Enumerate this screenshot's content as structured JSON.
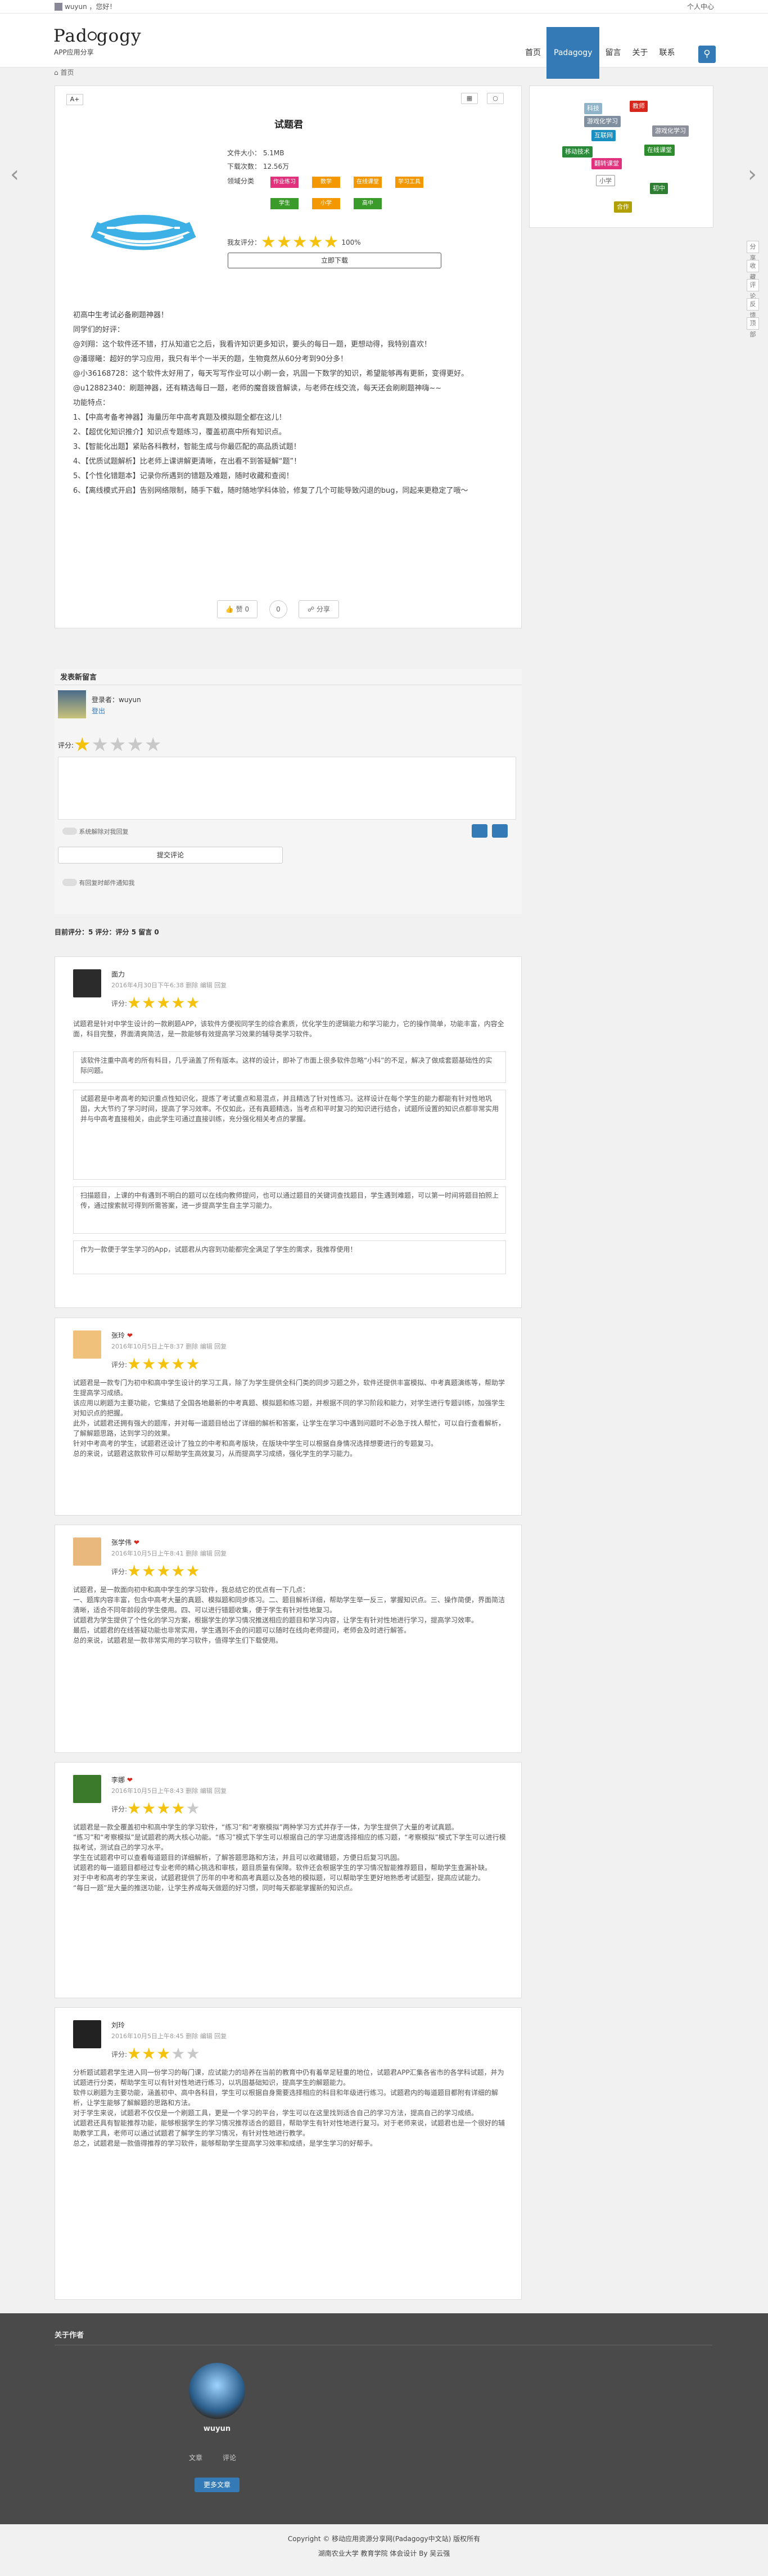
{
  "topbar": {
    "greeting": "wuyun ，您好！",
    "personal": "个人中心"
  },
  "nav": {
    "logo_left": "Pad",
    "logo_right": "gogy",
    "slogan": "APP应用分享",
    "menu": [
      "首页",
      "Padagogy",
      "留言",
      "关于",
      "联系"
    ]
  },
  "breadcrumb": "首页",
  "app": {
    "title": "试题君",
    "font_label": "A+",
    "size": "文件大小： 5.1MB",
    "downloads": "下载次数： 12.56万",
    "field_label": "领域分类",
    "tags": [
      {
        "t": "作业练习",
        "c": "#e2317c"
      },
      {
        "t": "数学",
        "c": "#f39800"
      },
      {
        "t": "在线课堂",
        "c": "#f39800"
      },
      {
        "t": "学习工具",
        "c": "#f39800"
      },
      {
        "t": "学生",
        "c": "#3a9a2a"
      },
      {
        "t": "小学",
        "c": "#f39800"
      },
      {
        "t": "高中",
        "c": "#3a9a2a"
      }
    ],
    "rating_label": "我友评分：",
    "rating_pct": "100%",
    "download_btn": "立即下载",
    "body": [
      "初高中生考试必备刷题神器！",
      "同学们的好评：",
      "@刘翔：这个软件还不错，打从知道它之后，我看许知识更多知识，要头的每日一题，更想动得，我特别喜欢！",
      "@潘璟曦：超好的学习应用，我只有半个一半天的题，生物竟然从60分考到90分多！",
      "@小36168728：这个软件太好用了，每天写写作业可以小刷一会，巩固一下数学的知识，希望能够再有更新，变得更好。",
      "@u12882340：刷题神器，还有精选每日一题，老师的魔音拨音解读，与老师在线交流，每天还会刷刷题神嗨~~",
      "功能特点：",
      "1、【中高考备考神器】海量历年中高考真题及模拟题全都在这儿！",
      "2、【超优化知识推介】知识点专题练习，覆盖初高中所有知识点。",
      "3、【智能化出题】紧贴各科教材，智能生成与你最匹配的高品质试题！",
      "4、【优质试题解析】比老师上课讲解更清晰，在出看不到答疑解“题”！",
      "5、【个性化错题本】记录你所遇到的错题及难题，随时收藏和查阅！",
      "6、【离线模式开启】告别网络限制，随手下载，随时随地学科体验，修复了几个可能导致闪退的bug，同起来更稳定了哦～"
    ],
    "share": [
      "赞 0",
      "0",
      "分享"
    ]
  },
  "sidebar_tags": [
    {
      "t": "科技",
      "c": "#8fb3c9"
    },
    {
      "t": "教师",
      "c": "#d9261c"
    },
    {
      "t": "互联网",
      "c": "#1b8fbf"
    },
    {
      "t": "游戏化学习",
      "c": "#8a8f9a"
    },
    {
      "t": "游戏化学习",
      "c": "#7f8fa0"
    },
    {
      "t": "移动技术",
      "c": "#2a8a3a"
    },
    {
      "t": "在线课堂",
      "c": "#2e8b2e"
    },
    {
      "t": "翻转课堂",
      "c": "#e2317c"
    },
    {
      "t": "小学",
      "c": "#666666"
    },
    {
      "t": "初中",
      "c": "#2e7d32"
    },
    {
      "t": "合作",
      "c": "#b2a000"
    }
  ],
  "comment_form": {
    "header": "发表新留言",
    "login": "登录者：wuyun",
    "logout": "登出",
    "rate_label": "评分:",
    "auto_reply": "系统解除对我回复",
    "submit": "提交评论",
    "notify": "有回复时邮件通知我"
  },
  "stats": "目前评分：5  评分：评分 5  留言 0",
  "comments": [
    {
      "name": "面力",
      "date": "2016年4月30日下午6:38",
      "actions": "删除  编辑  回复",
      "color": "#2b2b2b",
      "text": "试题君是针对中学生设计的一款刷题APP，该软件方便视同学生的综合素质，优化学生的逻辑能力和学习能力，它的操作简单，功能丰富，内容全面，科目完整，界面清爽简洁，是一款能够有效提高学习效果的辅导类学习软件。",
      "quotes": [
        "该软件注重中高考的所有科目，几乎涵盖了所有版本。这样的设计，即补了市面上很多软件忽略“小科”的不足，解决了做成套题基础性的实际问题。",
        "试题君是中考高考的知识重点性知识化，提炼了考试重点和易混点，并且精选了针对性练习。这样设计在每个学生的能力都能有针对性地巩固，大大节约了学习时间，提高了学习效率。不仅如此，还有真题精选，当考点和平时复习的知识进行结合，试题所设置的知识点都非常实用并与中高考直接相关，由此学生可通过直接训练，充分强化相关考点的掌握。",
        "扫描题目，上课的中有遇到不明白的题可以在线向教师提问，也可以通过题目的关键词查找题目，学生遇到难题，可以第一时间将题目拍照上传，通过搜索就可得到所需答案，进一步提高学生自主学习能力。",
        "作为一款便于学生学习的App，试题君从内容到功能都完全满足了学生的需求，我推荐使用！"
      ]
    },
    {
      "name": "张玲",
      "date": "2016年10月5日上午8:37",
      "actions": "删除  编辑  回复",
      "color": "#efc17a",
      "text": "试题君是一款专门为初中和高中学生设计的学习工具，除了为学生提供全科门类的同步习题之外，软件还提供丰富模拟、中考真题演练等，帮助学生提高学习成绩。\n该应用以刷题为主要功能，它集结了全国各地最新的中考真题、模拟题和练习题，并根据不同的学习阶段和能力，对学生进行专题训练，加强学生对知识点的把握。\n此外，试题君还拥有强大的题库，并对每一道题目给出了详细的解析和答案，让学生在学习中遇到问题时不必急于找人帮忙，可以自行查看解析，了解解题思路，达到学习的效果。\n针对中考高考的学生，试题君还设计了独立的中考和高考版块，在版块中学生可以根据自身情况选择想要进行的专题复习。\n总的来说，试题君这款软件可以帮助学生高效复习，从而提高学习成绩，强化学生的学习能力。"
    },
    {
      "name": "张学伟",
      "date": "2016年10月5日上午8:41",
      "actions": "删除  编辑  回复",
      "color": "#e8b87d",
      "text": "试题君，是一款面向初中和高中学生的学习软件，我总结它的优点有一下几点：\n一、题库内容丰富，包含中高考大量的真题、模拟题和同步练习。二、题目解析详细，帮助学生举一反三，掌握知识点。三、操作简便，界面简洁清晰，适合不同年龄段的学生使用。四、可以进行错题收集，便于学生有针对性地复习。\n试题君为学生提供了个性化的学习方案，根据学生的学习情况推送相应的题目和学习内容，让学生有针对性地进行学习，提高学习效率。\n最后，试题君的在线答疑功能也非常实用，学生遇到不会的问题可以随时在线向老师提问，老师会及时进行解答。\n总的来说，试题君是一款非常实用的学习软件，值得学生们下载使用。"
    },
    {
      "name": "李娜",
      "date": "2016年10月5日上午8:43",
      "actions": "删除  编辑  回复",
      "color": "#3a7a2a",
      "text": "试题君是一款全覆盖初中和高中学生的学习软件，“练习”和“考察模拟”两种学习方式并存于一体，为学生提供了大量的考试真题。\n“练习”和“考察模拟”是试题君的两大核心功能。“练习”模式下学生可以根据自己的学习进度选择相应的练习题，“考察模拟”模式下学生可以进行模拟考试，测试自己的学习水平。\n学生在试题君中可以查看每道题目的详细解析，了解答题思路和方法，并且可以收藏错题，方便日后复习巩固。\n试题君的每一道题目都经过专业老师的精心挑选和审核，题目质量有保障。软件还会根据学生的学习情况智能推荐题目，帮助学生查漏补缺。\n对于中考和高考的学生来说，试题君提供了历年的中考和高考真题以及各地的模拟题，可以帮助学生更好地熟悉考试题型，提高应试能力。\n“每日一题”是大量的推送功能，让学生养成每天做题的好习惯，同时每天都能掌握新的知识点。"
    },
    {
      "name": "刘玲",
      "date": "2016年10月5日上午8:45",
      "actions": "删除  编辑  回复",
      "color": "#222222",
      "text": "分析题试题君学生进入同一份学习的每门课，应试能力的培养在当前的教育中仍有着举足轻重的地位，试题君APP汇集各省市的各学科试题，并为试题进行分类，帮助学生可以有针对性地进行练习，以巩固基础知识，提高学生的解题能力。\n软件以刷题为主要功能，涵盖初中、高中各科目，学生可以根据自身需要选择相应的科目和年级进行练习。试题君内的每道题目都附有详细的解析，让学生能够了解解题的思路和方法。\n对于学生来说，试题君不仅仅是一个刷题工具，更是一个学习的平台，学生可以在这里找到适合自己的学习方法，提高自己的学习成绩。\n试题君还具有智能推荐功能，能够根据学生的学习情况推荐适合的题目，帮助学生有针对性地进行复习。对于老师来说，试题君也是一个很好的辅助教学工具，老师可以通过试题君了解学生的学习情况，有针对性地进行教学。\n总之，试题君是一款值得推荐的学习软件，能够帮助学生提高学习效率和成绩，是学生学习的好帮手。"
    }
  ],
  "footer": {
    "title": "关于作者",
    "user": "wuyun",
    "stat1": "文章",
    "stat2": "评论",
    "btn": "更多文章"
  },
  "copyright": [
    "Copyright ©  移动应用资源分享网(Padagogy中文站) 版权所有",
    "湖南农业大学 教育学院 体会设计 By 吴云强"
  ],
  "floating": [
    "分享",
    "收藏",
    "评论",
    "反馈",
    "顶部"
  ]
}
